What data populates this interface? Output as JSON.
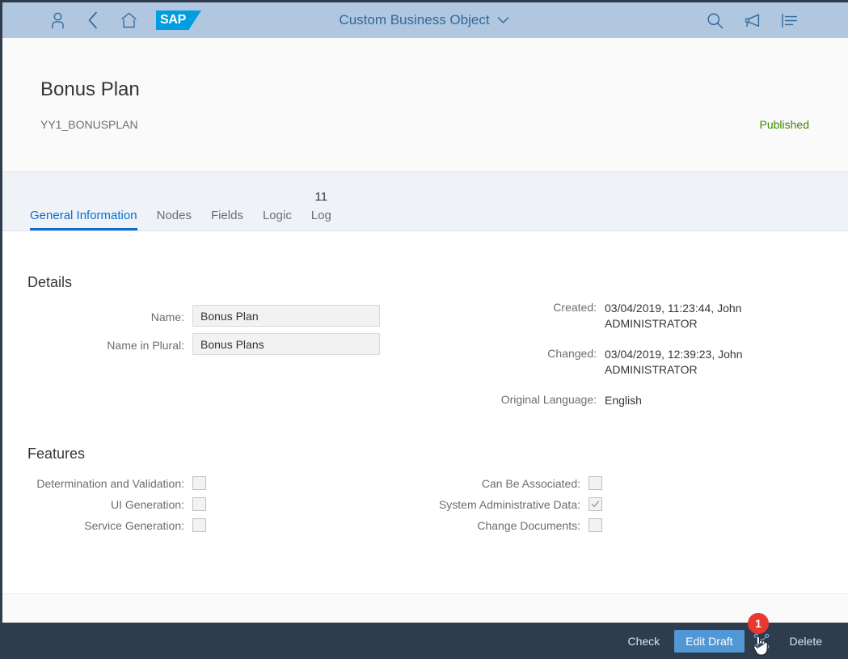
{
  "shell": {
    "title": "Custom Business Object",
    "icons": {
      "user": "user-icon",
      "back": "back-chevron-icon",
      "home": "home-icon",
      "logo": "sap-logo",
      "logo_text": "SAP",
      "caret": "chevron-down-icon",
      "search": "search-icon",
      "announcement": "megaphone-icon",
      "overflow": "list-menu-icon"
    },
    "colors": {
      "shell_bg": "#b0c7df",
      "shell_fg": "#32699b",
      "logo_blue": "#009ee0"
    }
  },
  "object_header": {
    "title": "Bonus Plan",
    "subtitle": "YY1_BONUSPLAN",
    "status": "Published",
    "status_color": "#3f8600"
  },
  "tabs": [
    {
      "label": "General Information",
      "count": "",
      "selected": true
    },
    {
      "label": "Nodes",
      "count": "",
      "selected": false
    },
    {
      "label": "Fields",
      "count": "",
      "selected": false
    },
    {
      "label": "Logic",
      "count": "",
      "selected": false
    },
    {
      "label": "Log",
      "count": "11",
      "selected": false
    }
  ],
  "details": {
    "section_title": "Details",
    "left": [
      {
        "label": "Name:",
        "value": "Bonus Plan"
      },
      {
        "label": "Name in Plural:",
        "value": "Bonus Plans"
      }
    ],
    "right": [
      {
        "label": "Created:",
        "value": "03/04/2019, 11:23:44, John ADMINISTRATOR"
      },
      {
        "label": "Changed:",
        "value": "03/04/2019, 12:39:23, John ADMINISTRATOR"
      },
      {
        "label": "Original Language:",
        "value": "English"
      }
    ]
  },
  "features": {
    "section_title": "Features",
    "left": [
      {
        "label": "Determination and Validation:",
        "checked": false
      },
      {
        "label": "UI Generation:",
        "checked": false
      },
      {
        "label": "Service Generation:",
        "checked": false
      }
    ],
    "right": [
      {
        "label": "Can Be Associated:",
        "checked": false
      },
      {
        "label": "System Administrative Data:",
        "checked": true
      },
      {
        "label": "Change Documents:",
        "checked": false
      }
    ]
  },
  "footer": {
    "check_label": "Check",
    "edit_draft_label": "Edit Draft",
    "share_icon": "share-network-icon",
    "delete_label": "Delete",
    "badge": "1",
    "badge_color": "#e8382f",
    "bar_color": "#2f3c4c",
    "primary_color": "#5196d5"
  }
}
